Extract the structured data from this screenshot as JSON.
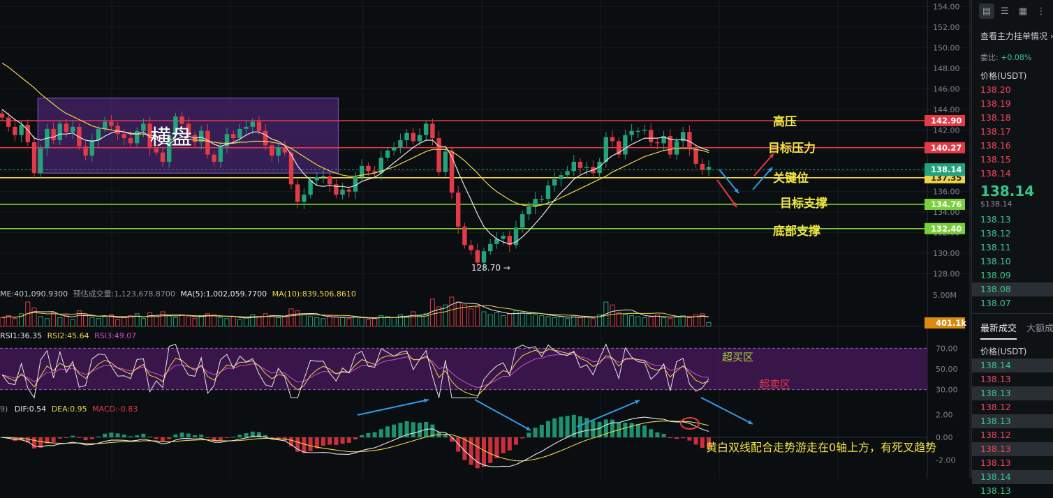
{
  "chart_data": [
    {
      "type": "candlestick",
      "axis_ticks": [
        "154.00",
        "152.00",
        "150.00",
        "148.00",
        "146.00",
        "144.00",
        "142.00",
        "140.00",
        "138.00",
        "136.00",
        "134.00",
        "132.00",
        "130.00",
        "128.00"
      ],
      "ylim": [
        127.5,
        154.5
      ],
      "annotations": {
        "range_label": "横盘",
        "resistance_high": "高压",
        "target_resistance": "目标压力",
        "key_level": "关键位",
        "target_support": "目标支撑",
        "bottom_support": "底部支撑",
        "low_marker": "128.70 →"
      },
      "levels": [
        {
          "value": 142.9,
          "label": "142.90",
          "color": "#e23a46"
        },
        {
          "value": 140.27,
          "label": "140.27",
          "color": "#e23a46"
        },
        {
          "value": 137.35,
          "label": "137.35",
          "color": "#f0d54a"
        },
        {
          "value": 134.76,
          "label": "134.76",
          "color": "#7ad03a"
        },
        {
          "value": 132.4,
          "label": "132.40",
          "color": "#7ad03a"
        }
      ],
      "current_price": "138.14",
      "close": [
        143.2,
        142.3,
        141.5,
        142.5,
        140.8,
        137.8,
        140.2,
        142.1,
        141.0,
        142.6,
        141.8,
        142.3,
        140.4,
        139.5,
        141.0,
        142.1,
        142.8,
        142.4,
        141.6,
        141.2,
        140.7,
        141.9,
        142.6,
        140.2,
        139.8,
        138.9,
        141.5,
        143.3,
        142.6,
        141.5,
        140.8,
        141.9,
        139.6,
        138.9,
        140.4,
        141.6,
        141.2,
        142.1,
        142.3,
        142.8,
        141.9,
        140.5,
        139.5,
        140.3,
        139.8,
        136.7,
        135.0,
        135.7,
        137.1,
        137.4,
        137.5,
        136.7,
        135.7,
        136.2,
        136.0,
        137.4,
        138.5,
        138.0,
        137.8,
        139.3,
        140.0,
        140.3,
        141.0,
        141.7,
        140.9,
        141.5,
        142.6,
        141.2,
        137.9,
        139.9,
        135.9,
        132.6,
        130.8,
        130.3,
        129.1,
        130.2,
        130.9,
        131.4,
        131.7,
        130.8,
        132.5,
        133.8,
        134.5,
        135.3,
        135.3,
        136.6,
        137.2,
        137.6,
        138.0,
        138.9,
        138.3,
        138.4,
        137.8,
        138.9,
        141.3,
        140.9,
        139.6,
        141.5,
        141.9,
        141.9,
        142.0,
        140.8,
        140.7,
        141.4,
        139.6,
        140.9,
        141.8,
        140.2,
        138.7,
        138.1,
        138.4
      ],
      "ma_white": [
        144.0,
        143.5,
        143.0,
        142.6,
        142.0,
        141.2,
        141.0,
        141.2,
        141.3,
        141.6,
        141.6,
        141.7,
        141.3,
        141.0,
        140.9,
        141.0,
        141.4,
        141.7,
        141.9,
        141.8,
        141.6,
        141.6,
        141.8,
        141.3,
        141.1,
        140.7,
        140.6,
        141.1,
        141.3,
        141.4,
        141.2,
        141.3,
        141.0,
        140.6,
        140.4,
        140.6,
        140.8,
        141.1,
        141.5,
        141.8,
        141.8,
        141.5,
        141.1,
        140.9,
        140.5,
        139.6,
        138.5,
        137.7,
        137.1,
        136.6,
        136.5,
        136.6,
        136.5,
        136.5,
        136.4,
        136.6,
        137.0,
        137.2,
        137.4,
        137.8,
        138.3,
        138.8,
        139.3,
        139.8,
        140.3,
        140.7,
        141.0,
        141.0,
        140.4,
        140.4,
        139.4,
        137.9,
        136.5,
        135.2,
        133.8,
        132.6,
        131.9,
        131.4,
        131.1,
        130.9,
        131.1,
        131.6,
        132.2,
        132.9,
        133.6,
        134.4,
        135.2,
        135.9,
        136.5,
        137.2,
        137.6,
        137.9,
        138.1,
        138.4,
        139.0,
        139.5,
        139.8,
        140.2,
        140.6,
        140.9,
        141.2,
        141.2,
        141.2,
        141.3,
        141.1,
        141.0,
        141.1,
        140.9,
        140.5,
        140.2,
        140.0
      ],
      "ma_yellow": [
        148.5,
        148.1,
        147.6,
        147.1,
        146.6,
        146.1,
        145.5,
        145.0,
        144.5,
        144.0,
        143.6,
        143.3,
        143.0,
        142.7,
        142.4,
        142.2,
        142.1,
        142.0,
        141.9,
        141.8,
        141.7,
        141.6,
        141.6,
        141.5,
        141.4,
        141.2,
        141.1,
        141.1,
        141.1,
        141.1,
        141.0,
        141.0,
        140.9,
        140.8,
        140.7,
        140.7,
        140.7,
        140.8,
        140.8,
        140.9,
        140.9,
        140.9,
        140.8,
        140.7,
        140.5,
        140.2,
        139.8,
        139.4,
        139.0,
        138.6,
        138.3,
        138.0,
        137.8,
        137.6,
        137.5,
        137.5,
        137.6,
        137.7,
        137.8,
        138.0,
        138.2,
        138.4,
        138.7,
        139.0,
        139.3,
        139.6,
        139.9,
        140.1,
        140.1,
        140.1,
        139.9,
        139.5,
        139.0,
        138.4,
        137.8,
        137.1,
        136.5,
        136.0,
        135.6,
        135.2,
        134.9,
        134.7,
        134.6,
        134.6,
        134.7,
        134.9,
        135.1,
        135.4,
        135.7,
        136.0,
        136.3,
        136.6,
        136.9,
        137.2,
        137.5,
        137.9,
        138.2,
        138.5,
        138.8,
        139.1,
        139.4,
        139.6,
        139.8,
        140.0,
        140.1,
        140.2,
        140.2,
        140.2,
        140.1,
        140.0,
        139.8
      ]
    },
    {
      "type": "bar",
      "name": "volume",
      "legend": {
        "prefix": "ME:401,090.9300",
        "predicted": "预估成交量:1,123,678.8700",
        "ma5": "MA(5):1,002,059.7700",
        "ma10": "MA(10):839,506.8610"
      },
      "axis_ticks": [
        "5.00M"
      ],
      "current": "401.1k",
      "values": [
        0.9,
        1.1,
        0.8,
        1.3,
        2.5,
        1.9,
        1.0,
        0.8,
        1.4,
        0.9,
        1.1,
        0.7,
        1.6,
        1.2,
        0.9,
        0.8,
        1.0,
        1.2,
        0.7,
        0.9,
        1.1,
        1.3,
        0.8,
        1.4,
        1.0,
        1.5,
        1.1,
        0.9,
        1.2,
        1.0,
        0.8,
        1.1,
        1.3,
        1.2,
        0.9,
        0.8,
        1.0,
        0.7,
        0.9,
        1.2,
        1.0,
        1.3,
        1.1,
        0.9,
        1.0,
        1.8,
        1.6,
        1.2,
        1.0,
        0.9,
        0.8,
        1.1,
        1.0,
        0.9,
        0.8,
        1.0,
        0.9,
        0.7,
        0.8,
        1.1,
        1.0,
        0.9,
        1.2,
        1.0,
        1.5,
        1.1,
        1.3,
        2.8,
        2.0,
        2.2,
        3.0,
        2.5,
        2.2,
        1.8,
        2.0,
        1.5,
        1.2,
        1.4,
        1.1,
        1.3,
        1.6,
        1.4,
        1.3,
        1.2,
        1.1,
        1.0,
        0.9,
        1.0,
        0.8,
        1.1,
        0.9,
        1.0,
        0.8,
        1.2,
        2.5,
        2.2,
        1.4,
        1.2,
        1.1,
        1.0,
        0.9,
        1.0,
        1.2,
        0.9,
        0.8,
        1.0,
        1.1,
        0.9,
        1.2,
        1.3,
        0.4
      ]
    },
    {
      "type": "line",
      "name": "RSI",
      "legend": {
        "rsi1": "RSI1:36.35",
        "rsi2": "RSI2:45.64",
        "rsi3": "RSI3:49.07"
      },
      "axis_ticks": [
        "70.00",
        "50.00",
        "30.00"
      ],
      "ylim": [
        25,
        75
      ],
      "zone_labels": {
        "overbought": "超买区",
        "oversold": "超卖区"
      }
    },
    {
      "type": "bar",
      "name": "MACD",
      "legend": {
        "prefix": "9)",
        "dif": "DIF:0.54",
        "dea": "DEA:0.95",
        "macd": "MACD:-0.83"
      },
      "axis_ticks": [
        "2.00",
        "0.00",
        "-2.00"
      ],
      "ylim": [
        -2.4,
        2.4
      ],
      "note": "黄白双线配合走势游走在0轴上方，有死叉趋势"
    }
  ],
  "right_panel": {
    "tools": [
      "chart-icon",
      "list-icon",
      "table-icon",
      "grid-icon"
    ],
    "link_label": "查看主力挂单情况",
    "ratio_label": "委比:",
    "ratio_value": "+0.08%",
    "price_header": "价格(USDT)",
    "asks": [
      "138.20",
      "138.19",
      "138.18",
      "138.17",
      "138.16",
      "138.15",
      "138.14"
    ],
    "last_price": "138.14",
    "last_price_sub": "$138.14",
    "bids": [
      "138.13",
      "138.12",
      "138.11",
      "138.10",
      "138.09",
      "138.08",
      "138.07"
    ],
    "tabs": {
      "latest": "最新成交",
      "large": "大额成"
    },
    "trades_header": "价格(USDT)",
    "trades": [
      {
        "p": "138.14",
        "c": "green"
      },
      {
        "p": "138.13",
        "c": "red"
      },
      {
        "p": "138.13",
        "c": "green"
      },
      {
        "p": "138.12",
        "c": "red"
      },
      {
        "p": "138.13",
        "c": "green"
      },
      {
        "p": "138.12",
        "c": "red"
      },
      {
        "p": "138.13",
        "c": "red"
      },
      {
        "p": "138.13",
        "c": "red"
      },
      {
        "p": "138.14",
        "c": "green"
      },
      {
        "p": "138.13",
        "c": "green"
      }
    ]
  },
  "colors": {
    "up": "#22a37c",
    "down": "#e23a46",
    "white_line": "#e8e8e8",
    "yellow_line": "#f0d54a",
    "zone_purple": "#6a2a8a",
    "accent_green": "#3bc48a"
  }
}
